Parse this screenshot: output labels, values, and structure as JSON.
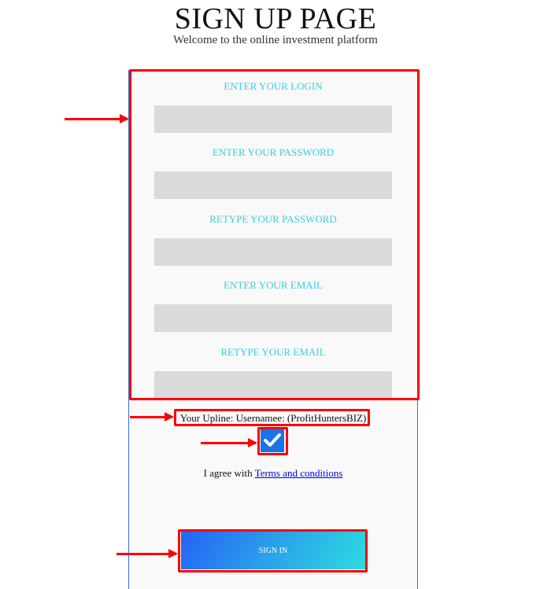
{
  "header": {
    "title": "SIGN UP PAGE",
    "subtitle": "Welcome to the online investment platform"
  },
  "form": {
    "fields": [
      {
        "label": "ENTER YOUR LOGIN",
        "value": "",
        "type": "text"
      },
      {
        "label": "ENTER YOUR PASSWORD",
        "value": "",
        "type": "password"
      },
      {
        "label": "RETYPE YOUR PASSWORD",
        "value": "",
        "type": "password"
      },
      {
        "label": "ENTER YOUR EMAIL",
        "value": "",
        "type": "email"
      },
      {
        "label": "RETYPE YOUR EMAIL",
        "value": "",
        "type": "email"
      }
    ],
    "upline_text": "Your Upline: Usernamee: (ProfitHuntersBIZ)",
    "agree_checked": true,
    "agree_prefix": "I agree with ",
    "terms_link": "Terms and conditions",
    "submit_label": "SIGN IN"
  },
  "colors": {
    "label": "#35d0df",
    "annotation": "#ff0000",
    "checkbox": "#1a73e8",
    "button_gradient_start": "#2563f6",
    "button_gradient_end": "#2bdce0"
  }
}
